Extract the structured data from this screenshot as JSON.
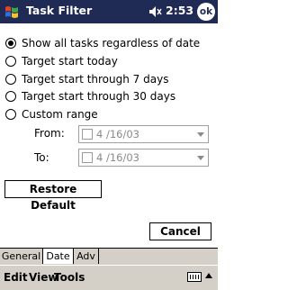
{
  "titlebar": {
    "title": "Task Filter",
    "clock": "2:53",
    "ok_label": "ok",
    "start_icon": "windows-flag-icon",
    "speaker_icon": "speaker-icon"
  },
  "options": {
    "all": "Show all tasks regardless of date",
    "today": "Target start today",
    "days7": "Target start through 7 days",
    "days30": "Target start through 30 days",
    "custom": "Custom range",
    "selected": "all"
  },
  "range": {
    "from_label": "From:",
    "from_value": "4 /16/03",
    "to_label": "To:",
    "to_value": "4 /16/03"
  },
  "buttons": {
    "restore": "Restore Default",
    "cancel": "Cancel"
  },
  "tabs": [
    "General",
    "Date",
    "Adv"
  ],
  "active_tab": "Date",
  "menu": [
    "Edit",
    "View",
    "Tools"
  ],
  "colors": {
    "titlebar": "#1f2a55",
    "chrome": "#d4d0c8",
    "disabled_text": "#8a8a8a"
  }
}
